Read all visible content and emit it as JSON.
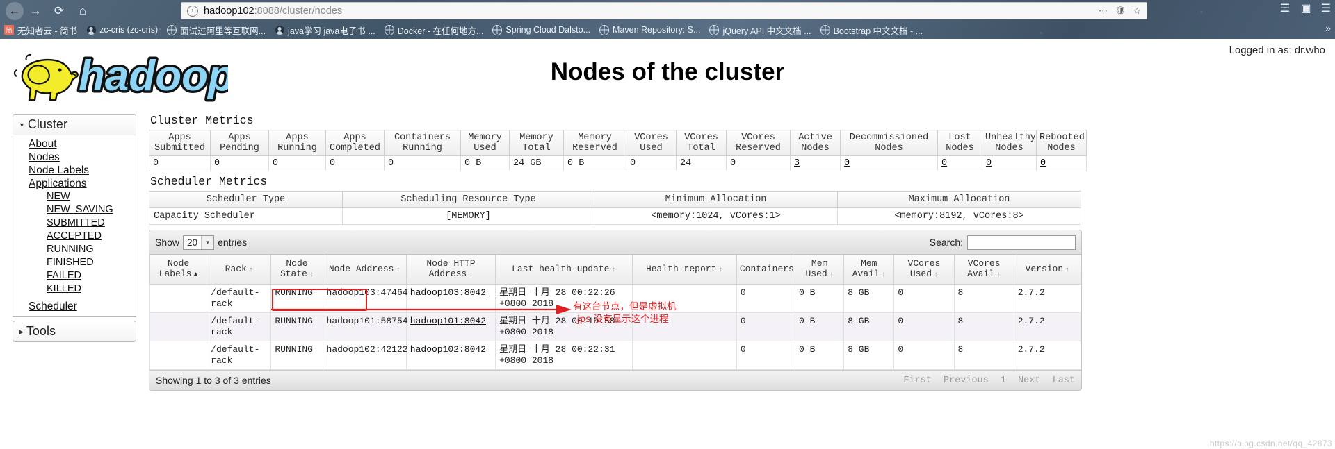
{
  "browser": {
    "nav_icons": [
      "back-arrow",
      "forward-arrow",
      "reload",
      "home"
    ],
    "url_host": "hadoop102",
    "url_path": ":8088/cluster/nodes",
    "url_right_icons": [
      "ellipsis",
      "shield",
      "star"
    ],
    "chrome_right_icons": [
      "library",
      "sidebar",
      "menu"
    ],
    "bookmarks": [
      {
        "icon": "jianshu-icon",
        "label": "无知者云 - 简书"
      },
      {
        "icon": "person-icon",
        "label": "zc-cris (zc-cris)"
      },
      {
        "icon": "globe-icon",
        "label": "面试过阿里等互联网..."
      },
      {
        "icon": "person-icon",
        "label": "java学习 java电子书 ..."
      },
      {
        "icon": "globe-icon",
        "label": "Docker - 在任何地方..."
      },
      {
        "icon": "globe-icon",
        "label": "Spring Cloud Dalsto..."
      },
      {
        "icon": "globe-icon",
        "label": "Maven Repository: S..."
      },
      {
        "icon": "globe-icon",
        "label": "jQuery API 中文文档 ..."
      },
      {
        "icon": "globe-icon",
        "label": "Bootstrap 中文文档 - ..."
      }
    ],
    "bookmarks_overflow": "»"
  },
  "header": {
    "logo_text": "hadoop",
    "page_title": "Nodes of the cluster",
    "logged_in_as": "Logged in as: dr.who"
  },
  "sidebar": {
    "cluster": {
      "title": "Cluster",
      "items": [
        {
          "label": "About"
        },
        {
          "label": "Nodes"
        },
        {
          "label": "Node Labels"
        },
        {
          "label": "Applications"
        }
      ],
      "application_states": [
        {
          "label": "NEW"
        },
        {
          "label": "NEW_SAVING"
        },
        {
          "label": "SUBMITTED"
        },
        {
          "label": "ACCEPTED"
        },
        {
          "label": "RUNNING"
        },
        {
          "label": "FINISHED"
        },
        {
          "label": "FAILED"
        },
        {
          "label": "KILLED"
        }
      ],
      "scheduler": {
        "label": "Scheduler"
      }
    },
    "tools": {
      "title": "Tools"
    }
  },
  "cluster_metrics": {
    "title": "Cluster Metrics",
    "headers": [
      "Apps\nSubmitted",
      "Apps\nPending",
      "Apps\nRunning",
      "Apps\nCompleted",
      "Containers\nRunning",
      "Memory\nUsed",
      "Memory\nTotal",
      "Memory\nReserved",
      "VCores\nUsed",
      "VCores\nTotal",
      "VCores\nReserved",
      "Active\nNodes",
      "Decommissioned\nNodes",
      "Lost\nNodes",
      "Unhealthy\nNodes",
      "Rebooted\nNodes"
    ],
    "values": [
      "0",
      "0",
      "0",
      "0",
      "0",
      "0 B",
      "24 GB",
      "0 B",
      "0",
      "24",
      "0",
      "3",
      "0",
      "0",
      "0",
      "0"
    ],
    "link_indices": [
      11,
      12,
      13,
      14,
      15
    ]
  },
  "scheduler_metrics": {
    "title": "Scheduler Metrics",
    "headers": [
      "Scheduler Type",
      "Scheduling Resource Type",
      "Minimum Allocation",
      "Maximum Allocation"
    ],
    "row": [
      "Capacity Scheduler",
      "[MEMORY]",
      "<memory:1024, vCores:1>",
      "<memory:8192, vCores:8>"
    ]
  },
  "nodes_table": {
    "show_label": "Show",
    "show_value": "20",
    "entries_label": "entries",
    "search_label": "Search:",
    "search_value": "",
    "headers": [
      {
        "label": "Node\nLabels",
        "sort": "asc"
      },
      {
        "label": "Rack",
        "sort": "both"
      },
      {
        "label": "Node\nState",
        "sort": "both"
      },
      {
        "label": "Node Address",
        "sort": "both"
      },
      {
        "label": "Node HTTP\nAddress",
        "sort": "both"
      },
      {
        "label": "Last health-update",
        "sort": "both"
      },
      {
        "label": "Health-report",
        "sort": "both"
      },
      {
        "label": "Containers",
        "sort": "both"
      },
      {
        "label": "Mem\nUsed",
        "sort": "both"
      },
      {
        "label": "Mem\nAvail",
        "sort": "both"
      },
      {
        "label": "VCores\nUsed",
        "sort": "both"
      },
      {
        "label": "VCores\nAvail",
        "sort": "both"
      },
      {
        "label": "Version",
        "sort": "both"
      }
    ],
    "rows": [
      {
        "node_labels": "",
        "rack": "/default-\nrack",
        "node_state": "RUNNING",
        "node_address": "hadoop103:47464",
        "node_http_address": "hadoop103:8042",
        "last_health_update": "星期日 十月 28 00:22:26\n+0800 2018",
        "health_report": "",
        "containers": "0",
        "mem_used": "0 B",
        "mem_avail": "8 GB",
        "vcores_used": "0",
        "vcores_avail": "8",
        "version": "2.7.2"
      },
      {
        "node_labels": "",
        "rack": "/default-\nrack",
        "node_state": "RUNNING",
        "node_address": "hadoop101:58754",
        "node_http_address": "hadoop101:8042",
        "last_health_update": "星期日 十月 28 00:19:58\n+0800 2018",
        "health_report": "",
        "containers": "0",
        "mem_used": "0 B",
        "mem_avail": "8 GB",
        "vcores_used": "0",
        "vcores_avail": "8",
        "version": "2.7.2"
      },
      {
        "node_labels": "",
        "rack": "/default-\nrack",
        "node_state": "RUNNING",
        "node_address": "hadoop102:42122",
        "node_http_address": "hadoop102:8042",
        "last_health_update": "星期日 十月 28 00:22:31\n+0800 2018",
        "health_report": "",
        "containers": "0",
        "mem_used": "0 B",
        "mem_avail": "8 GB",
        "vcores_used": "0",
        "vcores_avail": "8",
        "version": "2.7.2"
      }
    ],
    "footer_info": "Showing 1 to 3 of 3 entries",
    "pager": [
      "First",
      "Previous",
      "1",
      "Next",
      "Last"
    ]
  },
  "annotations": {
    "highlight_target": "hadoop101:8042",
    "note_line1": "有这台节点，但是虚拟机",
    "note_line2": "jps 没有显示这个进程",
    "color": "#e02020"
  },
  "watermark": "https://blog.csdn.net/qq_42873"
}
